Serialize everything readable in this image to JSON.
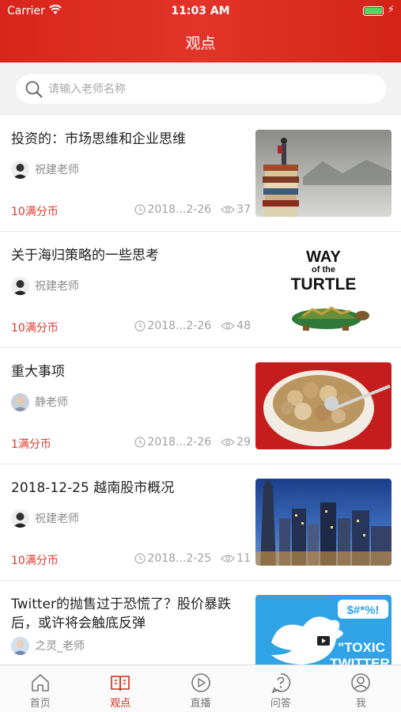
{
  "status": {
    "carrier": "Carrier",
    "time": "11:03 AM"
  },
  "header": {
    "title": "观点"
  },
  "search": {
    "placeholder": "请输入老师名称"
  },
  "articles": [
    {
      "title": "投资的：市场思维和企业思维",
      "author": "祝建老师",
      "price": "10满分币",
      "date": "2018...2-26",
      "views": "37",
      "thumb": "books-icon"
    },
    {
      "title": "关于海归策略的一些思考",
      "author": "祝建老师",
      "price": "10满分币",
      "date": "2018...2-26",
      "views": "48",
      "thumb": "turtle-icon",
      "thumb_text_1": "WAY",
      "thumb_text_2": "of the",
      "thumb_text_3": "TURTLE"
    },
    {
      "title": "重大事项",
      "author": "静老师",
      "price": "1满分币",
      "date": "2018...2-26",
      "views": "29",
      "thumb": "coins-icon"
    },
    {
      "title": "2018-12-25 越南股市概况",
      "author": "祝建老师",
      "price": "10满分币",
      "date": "2018...2-25",
      "views": "11",
      "thumb": "city-icon"
    },
    {
      "title": "Twitter的抛售过于恐慌了？股价暴跌后，或许将会触底反弹",
      "author": "之灵_老师",
      "thumb": "twitter-bird-icon",
      "thumb_text_1": "$#*%!",
      "thumb_text_2": "\"TOXIC",
      "thumb_text_3": "TWITTER"
    }
  ],
  "tabs": [
    {
      "label": "首页",
      "icon": "home-icon"
    },
    {
      "label": "观点",
      "icon": "book-icon",
      "active": true
    },
    {
      "label": "直播",
      "icon": "play-icon"
    },
    {
      "label": "问答",
      "icon": "question-icon"
    },
    {
      "label": "我",
      "icon": "user-icon"
    }
  ],
  "colors": {
    "brand": "#d9261c",
    "price": "#e0372c"
  }
}
